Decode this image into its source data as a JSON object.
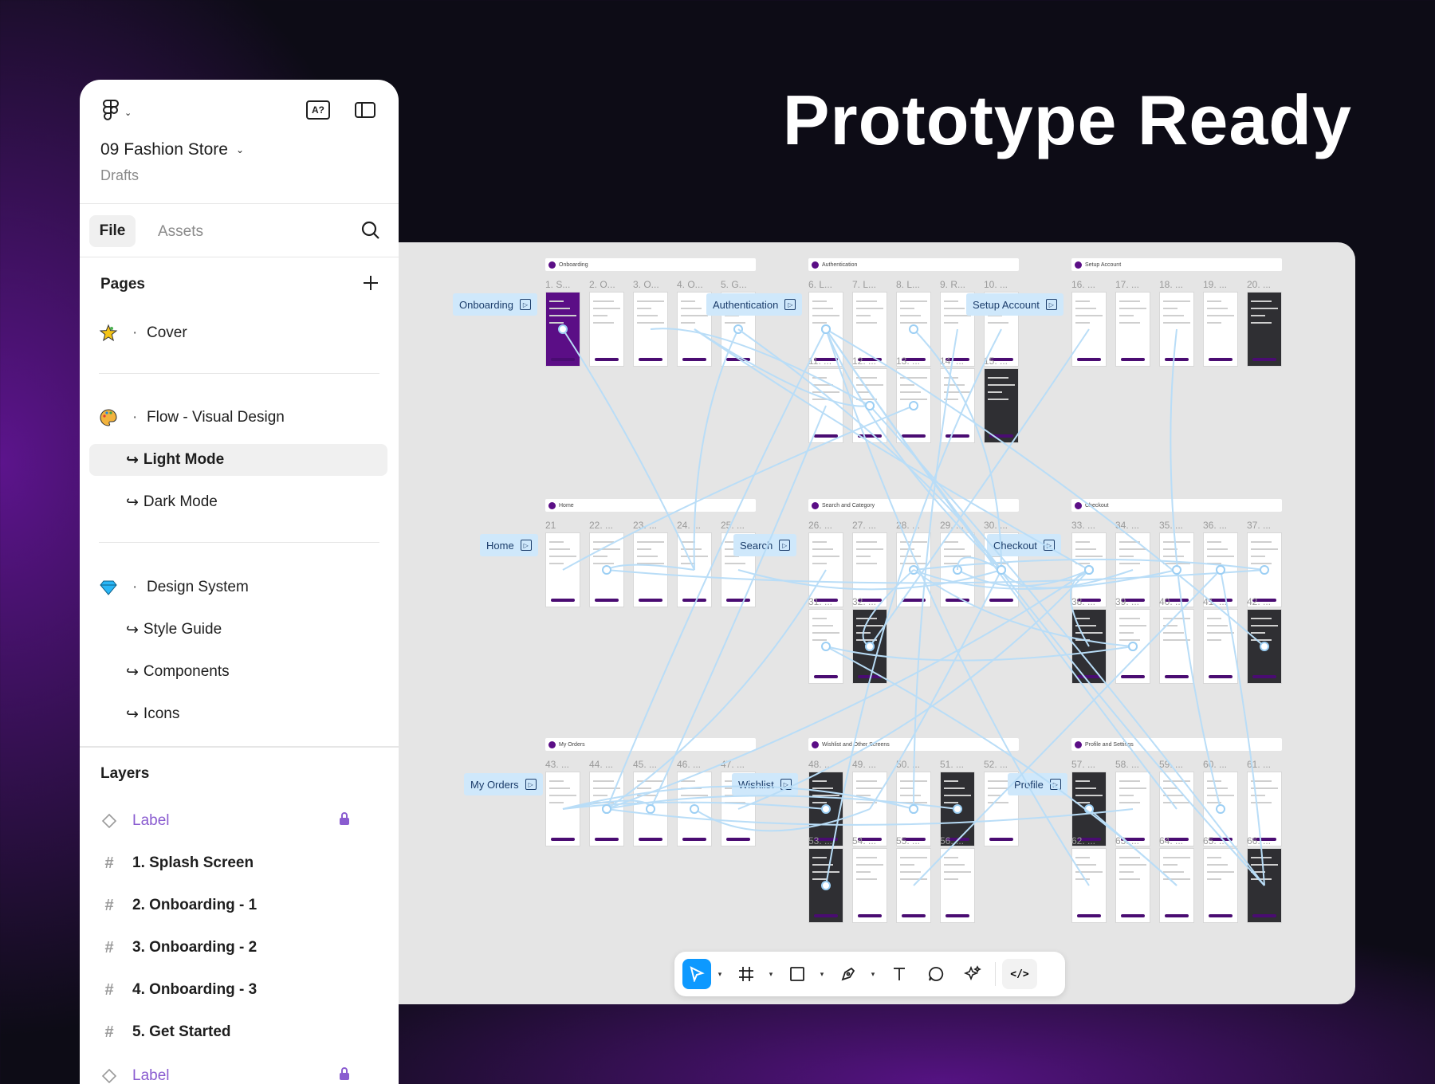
{
  "headline": "Prototype Ready",
  "sidebar": {
    "project_title": "09 Fashion Store",
    "project_subtitle": "Drafts",
    "font_badge": "A?",
    "tabs": {
      "file": "File",
      "assets": "Assets"
    },
    "pages_label": "Pages",
    "pages": [
      {
        "emoji": "star-icon",
        "label": "Cover"
      },
      {
        "emoji": "palette-icon",
        "label": "Flow - Visual Design"
      },
      {
        "label": "Light Mode",
        "selected": true
      },
      {
        "label": "Dark Mode"
      },
      {
        "emoji": "gem-icon",
        "label": "Design System"
      },
      {
        "label": "Style Guide"
      },
      {
        "label": "Components"
      },
      {
        "label": "Icons"
      }
    ],
    "layers_label": "Layers",
    "layers": [
      {
        "type": "component",
        "label": "Label",
        "locked": true
      },
      {
        "type": "frame",
        "label": "1. Splash Screen"
      },
      {
        "type": "frame",
        "label": "2. Onboarding - 1"
      },
      {
        "type": "frame",
        "label": "3. Onboarding - 2"
      },
      {
        "type": "frame",
        "label": "4. Onboarding - 3"
      },
      {
        "type": "frame",
        "label": "5. Get Started"
      },
      {
        "type": "component",
        "label": "Label",
        "locked": true
      }
    ]
  },
  "canvas": {
    "groups": [
      {
        "title": "Onboarding",
        "label": "Onboarding",
        "nums": [
          "1. S...",
          "2. O...",
          "3. O...",
          "4. O...",
          "5. G..."
        ],
        "nums2": []
      },
      {
        "title": "Authentication",
        "label": "Authentication",
        "nums": [
          "6. L...",
          "7. L...",
          "8. L...",
          "9. R...",
          "10. ..."
        ],
        "nums2": [
          "11. ...",
          "12. ...",
          "13. ...",
          "14. ...",
          "15. ..."
        ]
      },
      {
        "title": "Setup Account",
        "label": "Setup Account",
        "nums": [
          "16. ...",
          "17. ...",
          "18. ...",
          "19. ...",
          "20. ..."
        ],
        "nums2": []
      },
      {
        "title": "Home",
        "label": "Home",
        "nums": [
          "21",
          "22. ...",
          "23. ...",
          "24. ...",
          "25. ..."
        ],
        "nums2": []
      },
      {
        "title": "Search and Category",
        "label": "Search",
        "nums": [
          "26. ...",
          "27. ...",
          "28. ...",
          "29. ...",
          "30. ..."
        ],
        "nums2": [
          "31. ...",
          "32. ..."
        ]
      },
      {
        "title": "Checkout",
        "label": "Checkout",
        "nums": [
          "33. ...",
          "34. ...",
          "35. ...",
          "36. ...",
          "37. ..."
        ],
        "nums2": [
          "38. ...",
          "39. ...",
          "40. ...",
          "41. ...",
          "42. ..."
        ]
      },
      {
        "title": "My Orders",
        "label": "My Orders",
        "nums": [
          "43. ...",
          "44. ...",
          "45. ...",
          "46. ...",
          "47. ..."
        ],
        "nums2": []
      },
      {
        "title": "Wishlist and Other Screens",
        "label": "Wishlist",
        "nums": [
          "48. ...",
          "49. ...",
          "50. ...",
          "51. ...",
          "52. ..."
        ],
        "nums2": [
          "53. ...",
          "54. ...",
          "55. ...",
          "56. ..."
        ]
      },
      {
        "title": "Profile and Settings",
        "label": "Profile",
        "nums": [
          "57. ...",
          "58. ...",
          "59. ...",
          "60. ...",
          "61. ..."
        ],
        "nums2": [
          "62. ...",
          "63. ...",
          "64. ...",
          "65. ...",
          "66. ..."
        ]
      }
    ]
  },
  "toolbar": {
    "tools": [
      "move-tool",
      "frame-tool",
      "shape-tool",
      "pen-tool",
      "text-tool",
      "comment-tool",
      "actions-tool"
    ],
    "dev_mode_label": "</>"
  },
  "colors": {
    "accent": "#0d99ff",
    "brand_purple": "#5b0e86",
    "flow_label_bg": "#cfe8fb",
    "layer_component": "#8a5cd0"
  }
}
